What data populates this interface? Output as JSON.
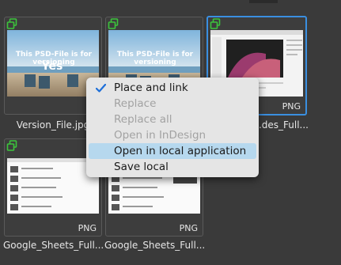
{
  "tiles": [
    {
      "caption": "Version_File.jpg",
      "format": "",
      "thumb_text": "This PSD-File is for versioning",
      "thumb_sub": "Yes"
    },
    {
      "caption": "",
      "format": "",
      "thumb_text": "This PSD-File is for versioning",
      "thumb_sub": ""
    },
    {
      "caption": "...des_Full...",
      "format": "PNG",
      "thumb_text": "",
      "thumb_sub": ""
    },
    {
      "caption": "Google_Sheets_Full...",
      "format": "PNG",
      "thumb_text": "",
      "thumb_sub": ""
    },
    {
      "caption": "Google_Sheets_Full...",
      "format": "PNG",
      "thumb_text": "",
      "thumb_sub": ""
    }
  ],
  "menu": {
    "items": [
      {
        "label": "Place and link",
        "checked": true,
        "enabled": true
      },
      {
        "label": "Replace",
        "checked": false,
        "enabled": false
      },
      {
        "label": "Replace all",
        "checked": false,
        "enabled": false
      },
      {
        "label": "Open in InDesign",
        "checked": false,
        "enabled": false
      },
      {
        "label": "Open in local application",
        "checked": false,
        "enabled": true,
        "highlighted": true
      },
      {
        "label": "Save local",
        "checked": false,
        "enabled": true
      }
    ]
  },
  "colors": {
    "accent": "#3a8fe0",
    "badge": "#3cc43c",
    "menu_highlight": "#b6d8ee"
  }
}
